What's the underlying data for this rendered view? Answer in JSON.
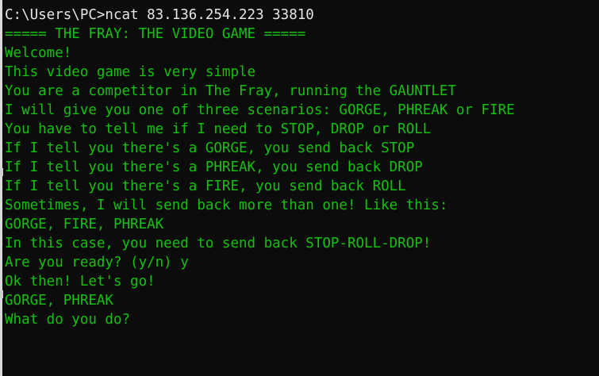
{
  "terminal": {
    "command_line": "C:\\Users\\PC>ncat 83.136.254.223 33810",
    "lines": [
      "===== THE FRAY: THE VIDEO GAME =====",
      "Welcome!",
      "This video game is very simple",
      "You are a competitor in The Fray, running the GAUNTLET",
      "I will give you one of three scenarios: GORGE, PHREAK or FIRE",
      "You have to tell me if I need to STOP, DROP or ROLL",
      "If I tell you there's a GORGE, you send back STOP",
      "If I tell you there's a PHREAK, you send back DROP",
      "If I tell you there's a FIRE, you send back ROLL",
      "Sometimes, I will send back more than one! Like this:",
      "GORGE, FIRE, PHREAK",
      "In this case, you need to send back STOP-ROLL-DROP!",
      "Are you ready? (y/n) y",
      "Ok then! Let's go!",
      "GORGE, PHREAK",
      "What do you do?"
    ],
    "colors": {
      "background": "#0c0c0c",
      "text_green": "#13c10e",
      "command_text": "#e6e6e6"
    }
  }
}
